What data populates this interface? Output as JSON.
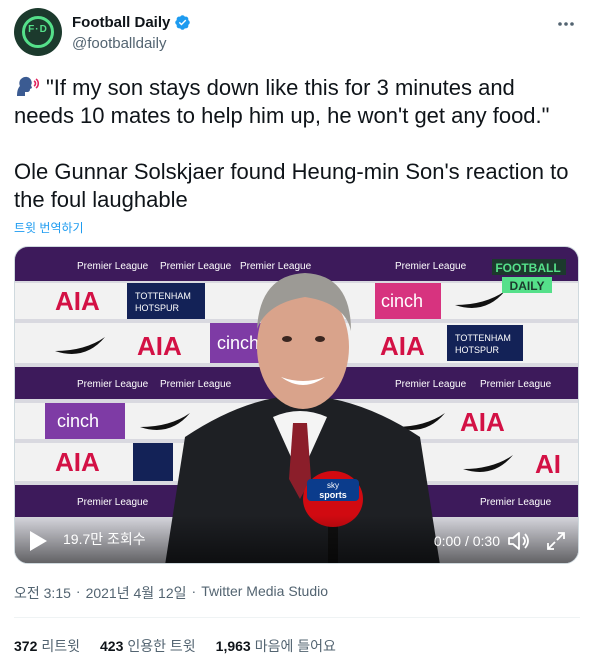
{
  "account": {
    "display_name": "Football Daily",
    "handle": "@footballdaily",
    "avatar_text": "F·D",
    "verified": true
  },
  "tweet": {
    "emoji_icon": "speaking-head-icon",
    "text_line1": "\"If my son stays down like this for 3 minutes and needs 10 mates to help him up, he won't get any food.\"",
    "text_line2": "Ole Gunnar Solskjaer found Heung-min Son's reaction to the foul laughable",
    "translate_label": "트윗 번역하기"
  },
  "video": {
    "watermark_line1": "FOOTBALL",
    "watermark_line2": "DAILY",
    "views": "19.7만 조회수",
    "time": "0:00 / 0:30",
    "board": {
      "premier_league": "Premier League",
      "aia": "AIA",
      "cinch": "cinch",
      "tottenham": "TOTTENHAM HOTSPUR",
      "sky_sports": "sky sports"
    }
  },
  "meta": {
    "time": "오전 3:15",
    "date": "2021년 4월 12일",
    "source": "Twitter Media Studio"
  },
  "stats": {
    "retweets_count": "372",
    "retweets_label": "리트윗",
    "quotes_count": "423",
    "quotes_label": "인용한 트윗",
    "likes_count": "1,963",
    "likes_label": "마음에 들어요"
  },
  "colors": {
    "accent": "#1d9bf0",
    "brand_green": "#55e08a",
    "premier_purple": "#37003c",
    "aia_red": "#d31145"
  }
}
